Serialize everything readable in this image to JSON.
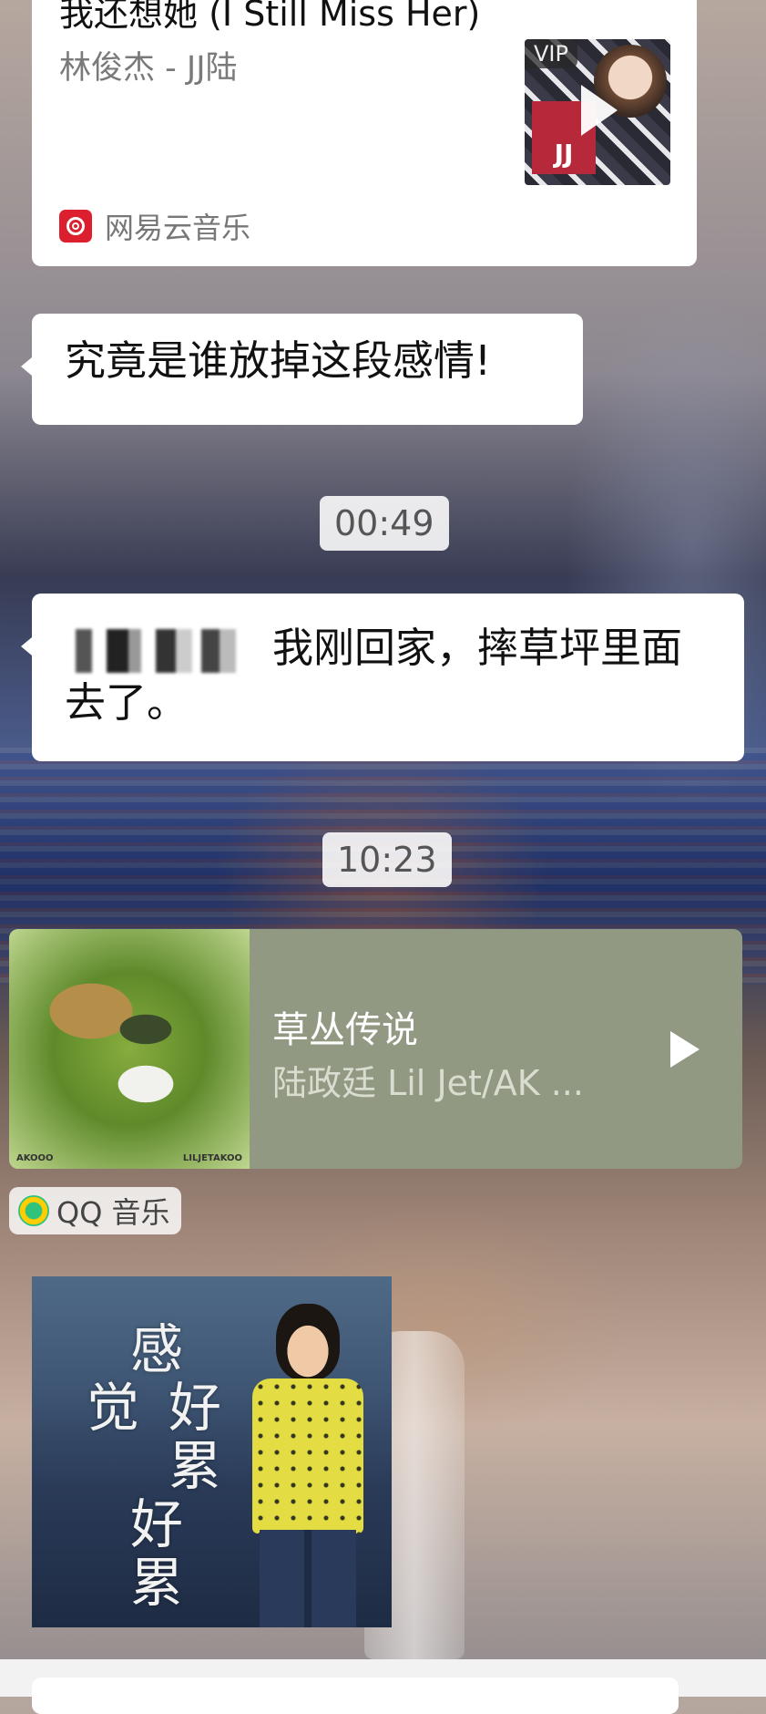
{
  "music_card_1": {
    "title": "我还想她 (I Still Miss Her)",
    "artist": "林俊杰 - JJ陆",
    "badge": "VIP",
    "source": "网易云音乐",
    "source_icon": "netease-music-icon"
  },
  "messages": [
    {
      "text": "究竟是谁放掉这段感情!"
    },
    {
      "text": "我刚回家，摔草坪里面去了。"
    }
  ],
  "timestamps": [
    "00:49",
    "10:23"
  ],
  "music_card_2": {
    "title": "草丛传说",
    "artist": "陆政廷 Lil Jet/AK ...",
    "source": "QQ 音乐",
    "source_icon": "qq-music-icon",
    "accent": "#929982"
  },
  "image_message": {
    "chars": [
      "感",
      "觉",
      "好",
      "累",
      "好",
      "累"
    ]
  }
}
